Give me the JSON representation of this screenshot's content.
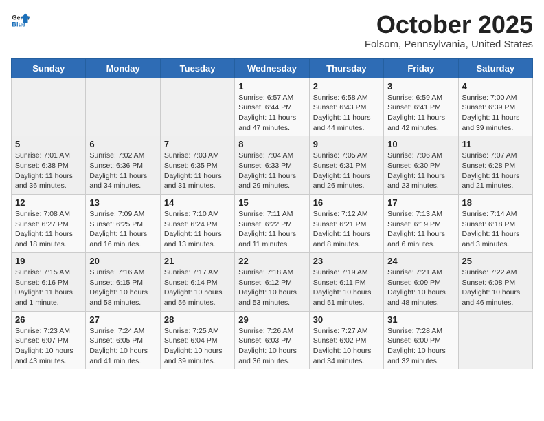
{
  "header": {
    "logo_general": "General",
    "logo_blue": "Blue",
    "month": "October 2025",
    "location": "Folsom, Pennsylvania, United States"
  },
  "days_of_week": [
    "Sunday",
    "Monday",
    "Tuesday",
    "Wednesday",
    "Thursday",
    "Friday",
    "Saturday"
  ],
  "weeks": [
    [
      {
        "day": "",
        "info": ""
      },
      {
        "day": "",
        "info": ""
      },
      {
        "day": "",
        "info": ""
      },
      {
        "day": "1",
        "info": "Sunrise: 6:57 AM\nSunset: 6:44 PM\nDaylight: 11 hours and 47 minutes."
      },
      {
        "day": "2",
        "info": "Sunrise: 6:58 AM\nSunset: 6:43 PM\nDaylight: 11 hours and 44 minutes."
      },
      {
        "day": "3",
        "info": "Sunrise: 6:59 AM\nSunset: 6:41 PM\nDaylight: 11 hours and 42 minutes."
      },
      {
        "day": "4",
        "info": "Sunrise: 7:00 AM\nSunset: 6:39 PM\nDaylight: 11 hours and 39 minutes."
      }
    ],
    [
      {
        "day": "5",
        "info": "Sunrise: 7:01 AM\nSunset: 6:38 PM\nDaylight: 11 hours and 36 minutes."
      },
      {
        "day": "6",
        "info": "Sunrise: 7:02 AM\nSunset: 6:36 PM\nDaylight: 11 hours and 34 minutes."
      },
      {
        "day": "7",
        "info": "Sunrise: 7:03 AM\nSunset: 6:35 PM\nDaylight: 11 hours and 31 minutes."
      },
      {
        "day": "8",
        "info": "Sunrise: 7:04 AM\nSunset: 6:33 PM\nDaylight: 11 hours and 29 minutes."
      },
      {
        "day": "9",
        "info": "Sunrise: 7:05 AM\nSunset: 6:31 PM\nDaylight: 11 hours and 26 minutes."
      },
      {
        "day": "10",
        "info": "Sunrise: 7:06 AM\nSunset: 6:30 PM\nDaylight: 11 hours and 23 minutes."
      },
      {
        "day": "11",
        "info": "Sunrise: 7:07 AM\nSunset: 6:28 PM\nDaylight: 11 hours and 21 minutes."
      }
    ],
    [
      {
        "day": "12",
        "info": "Sunrise: 7:08 AM\nSunset: 6:27 PM\nDaylight: 11 hours and 18 minutes."
      },
      {
        "day": "13",
        "info": "Sunrise: 7:09 AM\nSunset: 6:25 PM\nDaylight: 11 hours and 16 minutes."
      },
      {
        "day": "14",
        "info": "Sunrise: 7:10 AM\nSunset: 6:24 PM\nDaylight: 11 hours and 13 minutes."
      },
      {
        "day": "15",
        "info": "Sunrise: 7:11 AM\nSunset: 6:22 PM\nDaylight: 11 hours and 11 minutes."
      },
      {
        "day": "16",
        "info": "Sunrise: 7:12 AM\nSunset: 6:21 PM\nDaylight: 11 hours and 8 minutes."
      },
      {
        "day": "17",
        "info": "Sunrise: 7:13 AM\nSunset: 6:19 PM\nDaylight: 11 hours and 6 minutes."
      },
      {
        "day": "18",
        "info": "Sunrise: 7:14 AM\nSunset: 6:18 PM\nDaylight: 11 hours and 3 minutes."
      }
    ],
    [
      {
        "day": "19",
        "info": "Sunrise: 7:15 AM\nSunset: 6:16 PM\nDaylight: 11 hours and 1 minute."
      },
      {
        "day": "20",
        "info": "Sunrise: 7:16 AM\nSunset: 6:15 PM\nDaylight: 10 hours and 58 minutes."
      },
      {
        "day": "21",
        "info": "Sunrise: 7:17 AM\nSunset: 6:14 PM\nDaylight: 10 hours and 56 minutes."
      },
      {
        "day": "22",
        "info": "Sunrise: 7:18 AM\nSunset: 6:12 PM\nDaylight: 10 hours and 53 minutes."
      },
      {
        "day": "23",
        "info": "Sunrise: 7:19 AM\nSunset: 6:11 PM\nDaylight: 10 hours and 51 minutes."
      },
      {
        "day": "24",
        "info": "Sunrise: 7:21 AM\nSunset: 6:09 PM\nDaylight: 10 hours and 48 minutes."
      },
      {
        "day": "25",
        "info": "Sunrise: 7:22 AM\nSunset: 6:08 PM\nDaylight: 10 hours and 46 minutes."
      }
    ],
    [
      {
        "day": "26",
        "info": "Sunrise: 7:23 AM\nSunset: 6:07 PM\nDaylight: 10 hours and 43 minutes."
      },
      {
        "day": "27",
        "info": "Sunrise: 7:24 AM\nSunset: 6:05 PM\nDaylight: 10 hours and 41 minutes."
      },
      {
        "day": "28",
        "info": "Sunrise: 7:25 AM\nSunset: 6:04 PM\nDaylight: 10 hours and 39 minutes."
      },
      {
        "day": "29",
        "info": "Sunrise: 7:26 AM\nSunset: 6:03 PM\nDaylight: 10 hours and 36 minutes."
      },
      {
        "day": "30",
        "info": "Sunrise: 7:27 AM\nSunset: 6:02 PM\nDaylight: 10 hours and 34 minutes."
      },
      {
        "day": "31",
        "info": "Sunrise: 7:28 AM\nSunset: 6:00 PM\nDaylight: 10 hours and 32 minutes."
      },
      {
        "day": "",
        "info": ""
      }
    ]
  ]
}
